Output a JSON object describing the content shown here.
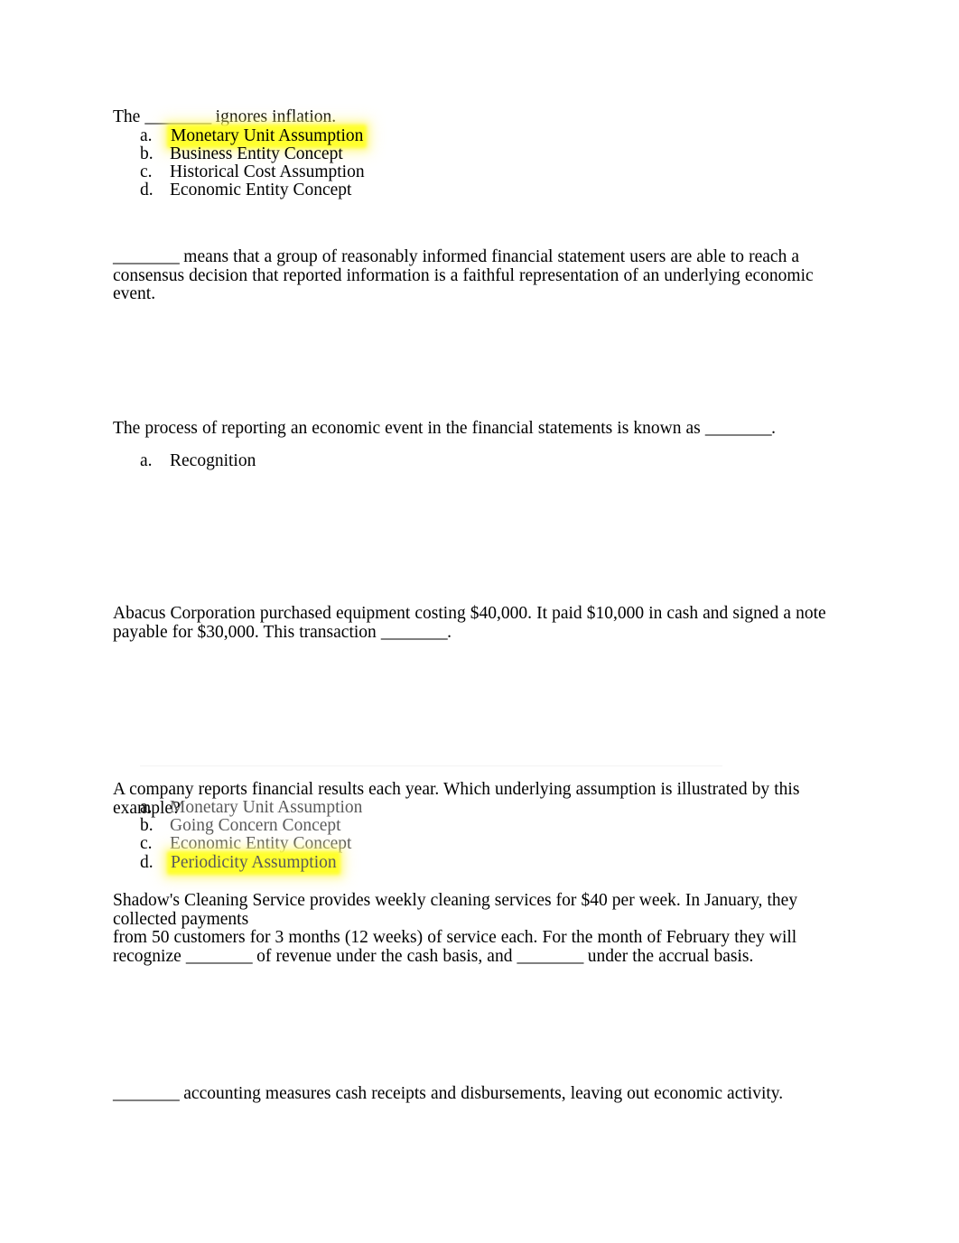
{
  "document": {
    "type": "accounting-quiz-worksheet",
    "highlight_color": "#ffff2e",
    "text_color": "#000000",
    "muted_text_color": "#5a5a5a",
    "page_background": "#ffffff"
  },
  "blanks": {
    "short": "________",
    "medium": "________"
  },
  "questions": [
    {
      "id": "q1",
      "stem_before": "The ",
      "stem_blank": "________",
      "stem_after": " ignores inflation.",
      "options": [
        {
          "marker": "a.",
          "text": "Monetary Unit Assumption",
          "highlighted": true,
          "muted": false
        },
        {
          "marker": "b.",
          "text": "Business Entity Concept",
          "highlighted": false,
          "muted": false
        },
        {
          "marker": "c.",
          "text": "Historical Cost Assumption",
          "highlighted": false,
          "muted": false
        },
        {
          "marker": "d.",
          "text": "Economic Entity Concept",
          "highlighted": false,
          "muted": false
        }
      ]
    },
    {
      "id": "q2",
      "stem_blank": "________",
      "stem_after": " means that a group of reasonably informed financial statement users are able to reach a consensus decision that reported information is a faithful representation of an underlying economic event.",
      "options": []
    },
    {
      "id": "q3",
      "stem_before": "The process of reporting an economic event in the financial statements is known as ",
      "stem_blank": "________",
      "stem_after": ".",
      "options": [
        {
          "marker": "a.",
          "text": "Recognition",
          "highlighted": false,
          "muted": false
        }
      ]
    },
    {
      "id": "q4",
      "stem_before": "Abacus Corporation purchased equipment costing $40,000. It paid $10,000 in cash and signed a note payable for $30,000. This transaction ",
      "stem_blank": "________",
      "stem_after": ".",
      "options": []
    },
    {
      "id": "q5",
      "stem_before": "A company reports financial results each year. Which underlying assumption is illustrated by this example?",
      "options": [
        {
          "marker": "a.",
          "text": "Monetary Unit Assumption",
          "highlighted": false,
          "muted": true
        },
        {
          "marker": "b.",
          "text": "Going Concern Concept",
          "highlighted": false,
          "muted": true
        },
        {
          "marker": "c.",
          "text": "Economic Entity Concept",
          "highlighted": false,
          "muted": true
        },
        {
          "marker": "d.",
          "text": "Periodicity Assumption",
          "highlighted": true,
          "muted": true
        }
      ]
    },
    {
      "id": "q6",
      "line1": "Shadow's Cleaning Service provides weekly cleaning services for $40 per week. In January, they collected payments",
      "line2": "from 50 customers for 3 months (12 weeks) of service each. For the month of February they will",
      "line3_before": "recognize ",
      "line3_blank1": "________",
      "line3_middle": " of revenue under the cash basis, and ",
      "line3_blank2": "________",
      "line3_after": " under the accrual basis."
    },
    {
      "id": "q7",
      "stem_blank": "________",
      "stem_after": " accounting measures cash receipts and disbursements,  leaving out economic activity."
    }
  ]
}
